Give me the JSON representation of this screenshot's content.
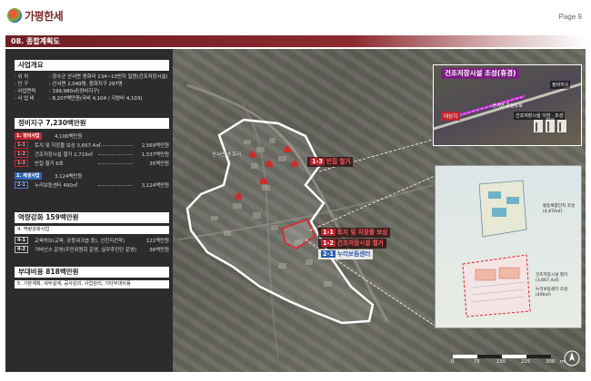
{
  "header": {
    "logo_text": "가평한세",
    "page_label": "Page 9"
  },
  "title": "08. 종합계획도",
  "info": {
    "project_overview": {
      "title": "사업개요",
      "lines": [
        {
          "label": "· 위    치",
          "value": ": 장수군 산서면 동화리 134~13번지 일원(건조저장시설)"
        },
        {
          "label": "· 인    구",
          "value": ": 산서면 2,049명, 동화지구 297명"
        },
        {
          "label": "· 사업면적",
          "value": ": 199,980㎡(정비지구)"
        },
        {
          "label": "· 사 업 비",
          "value": ": 8,207백만원(국비 4,104 / 지방비 4,103)"
        }
      ]
    },
    "maintenance": {
      "title": "정비지구 7,230백만원",
      "groups": [
        {
          "header_code": "1. 정비사업",
          "header_amount": "4,106백만원",
          "items": [
            {
              "code": "1-1",
              "text": "토지 및 지장물 보상 3,667.4㎡",
              "amount": "2,569백만원"
            },
            {
              "code": "1-2",
              "text": "건조저장시설 철거 2,719㎡",
              "amount": "1,537백만원"
            },
            {
              "code": "1-3",
              "text": "빈집 철거 6호",
              "amount": "35백만원"
            }
          ]
        },
        {
          "header_code": "2. 재생사업",
          "header_amount": "3,124백만원",
          "items": [
            {
              "code": "2-1",
              "text": "누리보듬센터 490㎡",
              "amount": "3,124백만원"
            }
          ]
        }
      ]
    },
    "capacity": {
      "title": "역량강화 159백만원",
      "subheader": "4. 역량강화사업",
      "items": [
        {
          "code": "4-1",
          "text": "교육허브(교육, 공동워크숍 등), 선진지견학)",
          "amount": "121백만원"
        },
        {
          "code": "4-2",
          "text": "거버넌스 운영(주민위원회 운영, 실무추진단 운영)",
          "amount": "38백만원"
        }
      ]
    },
    "incidental": {
      "title": "부대비용 818백만원",
      "note": "5. 기본계획, 세부설계, 공사감리, 사업관리, 기타부대비용"
    }
  },
  "map": {
    "village_label": "산서면 동화리",
    "callouts": [
      {
        "code": "1-3",
        "text": "빈집 철거"
      },
      {
        "code": "1-1",
        "text": "토지 및 지장물 보상"
      },
      {
        "code": "1-2",
        "text": "건조저장시설 철거"
      },
      {
        "code": "2-1",
        "text": "누리보듬센터"
      }
    ]
  },
  "inset_aerial": {
    "title": "건조저장시설 조성(휴경)",
    "district": "정비지구",
    "site": "대상지",
    "road": "산서면 중심도로",
    "facility": "건조저장시설 이전 · 조성"
  },
  "inset_plan": {
    "label_parking": "활동복합단지 조성",
    "label_parking_area": "(4,870㎡)",
    "label_demolish": "건조저장시설 철거",
    "label_demolish_area": "(3,667.4㎡)",
    "label_center": "누리보듬센터 조성",
    "label_center_area": "(490㎡)"
  },
  "scale": {
    "ticks": [
      "0",
      "75",
      "150",
      "225",
      "300"
    ],
    "unit": "m"
  },
  "colors": {
    "title_bar": "#6d1f24",
    "red": "#c3272e",
    "blue": "#3166b3",
    "panel": "#2d2b2d",
    "purple": "#7b1d82"
  }
}
